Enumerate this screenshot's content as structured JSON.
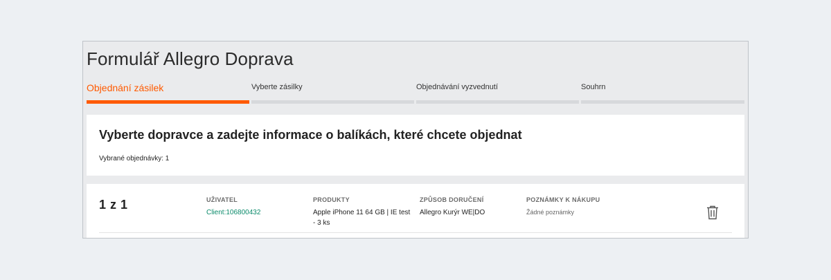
{
  "window": {
    "title": "Formulář Allegro Doprava"
  },
  "steps": [
    {
      "label": "Objednání zásilek",
      "active": true
    },
    {
      "label": "Vyberte zásilky",
      "active": false
    },
    {
      "label": "Objednávání vyzvednutí",
      "active": false
    },
    {
      "label": "Souhrn",
      "active": false
    }
  ],
  "header_card": {
    "heading": "Vyberte dopravce a zadejte informace o balíkách, které chcete objednat",
    "selected_orders": "Vybrané objednávky: 1"
  },
  "order_row": {
    "counter": "1 z 1",
    "user": {
      "label": "UŽIVATEL",
      "value": "Client:106800432"
    },
    "products": {
      "label": "PRODUKTY",
      "value": "Apple iPhone 11 64 GB | IE test - 3 ks"
    },
    "delivery": {
      "label": "ZPŮSOB DORUČENÍ",
      "value": "Allegro Kurýr WE|DO"
    },
    "notes": {
      "label": "POZNÁMKY K NÁKUPU",
      "value": "Žádné poznámky"
    },
    "delete_icon": "trash-icon"
  },
  "colors": {
    "accent": "#ff5a00",
    "link": "#0a8a6a",
    "inactive_bar": "#d7d9dc"
  }
}
